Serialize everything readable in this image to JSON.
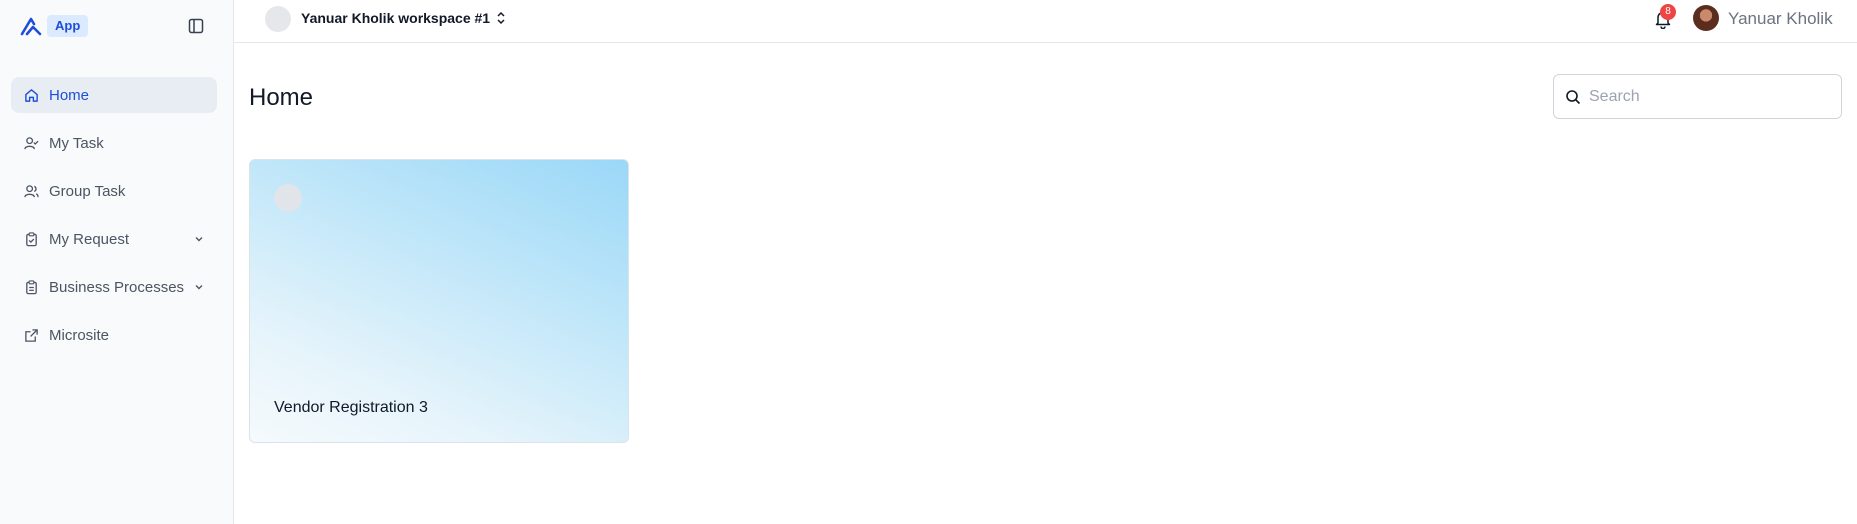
{
  "sidebar": {
    "app_badge": "App",
    "items": [
      {
        "label": "Home",
        "icon": "home-icon",
        "active": true
      },
      {
        "label": "My Task",
        "icon": "user-check-icon"
      },
      {
        "label": "Group Task",
        "icon": "users-icon"
      },
      {
        "label": "My Request",
        "icon": "clipboard-check-icon",
        "expandable": true
      },
      {
        "label": "Business Processes",
        "icon": "clipboard-list-icon",
        "expandable": true
      },
      {
        "label": "Microsite",
        "icon": "external-link-icon"
      }
    ]
  },
  "header": {
    "workspace_name": "Yanuar Kholik workspace #1",
    "notification_count": "8",
    "user_name": "Yanuar Kholik"
  },
  "main": {
    "title": "Home",
    "search": {
      "placeholder": "Search",
      "value": ""
    },
    "cards": [
      {
        "title": "Vendor Registration 3"
      }
    ]
  },
  "colors": {
    "accent": "#1d4ed8",
    "active_nav_bg": "#e8edf4",
    "badge_red": "#ef4444",
    "card_gradient_top": "#9ad8f8"
  }
}
